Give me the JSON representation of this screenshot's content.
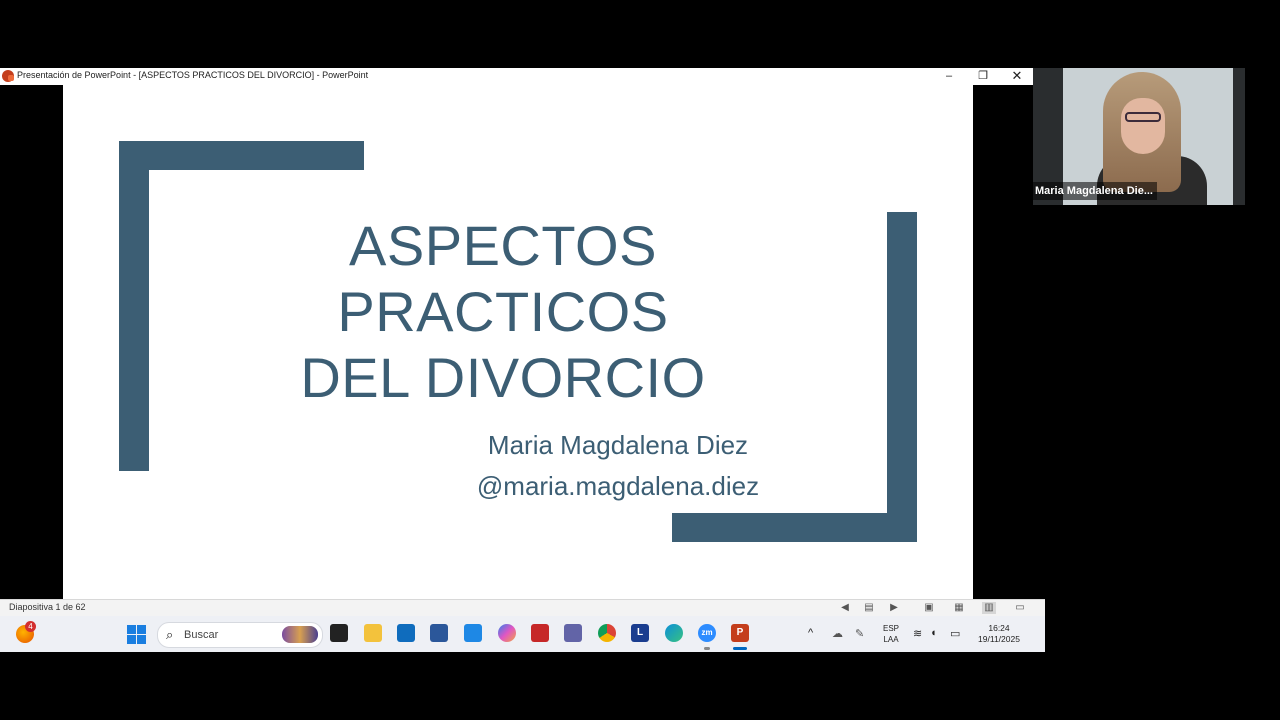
{
  "window": {
    "title": "Presentación de PowerPoint - [ASPECTOS PRACTICOS DEL DIVORCIO] - PowerPoint",
    "minimize_glyph": "–",
    "restore_glyph": "❐",
    "close_glyph": "✕"
  },
  "slide": {
    "title_line1": "ASPECTOS PRACTICOS",
    "title_line2": "DEL DIVORCIO",
    "presenter_name": "Maria Magdalena Diez",
    "presenter_handle": "@maria.magdalena.diez",
    "accent_color": "#3c5e74"
  },
  "status_bar": {
    "slide_counter": "Diapositiva 1 de 62"
  },
  "taskbar": {
    "weather_badge": "4",
    "search_placeholder": "Buscar",
    "apps": {
      "l_app": "L",
      "zoom": "zm",
      "powerpoint": "P"
    },
    "language_line1": "ESP",
    "language_line2": "LAA",
    "time": "16:24",
    "date": "19/11/2025"
  },
  "video_call": {
    "participant_name": "Maria Magdalena Die..."
  }
}
